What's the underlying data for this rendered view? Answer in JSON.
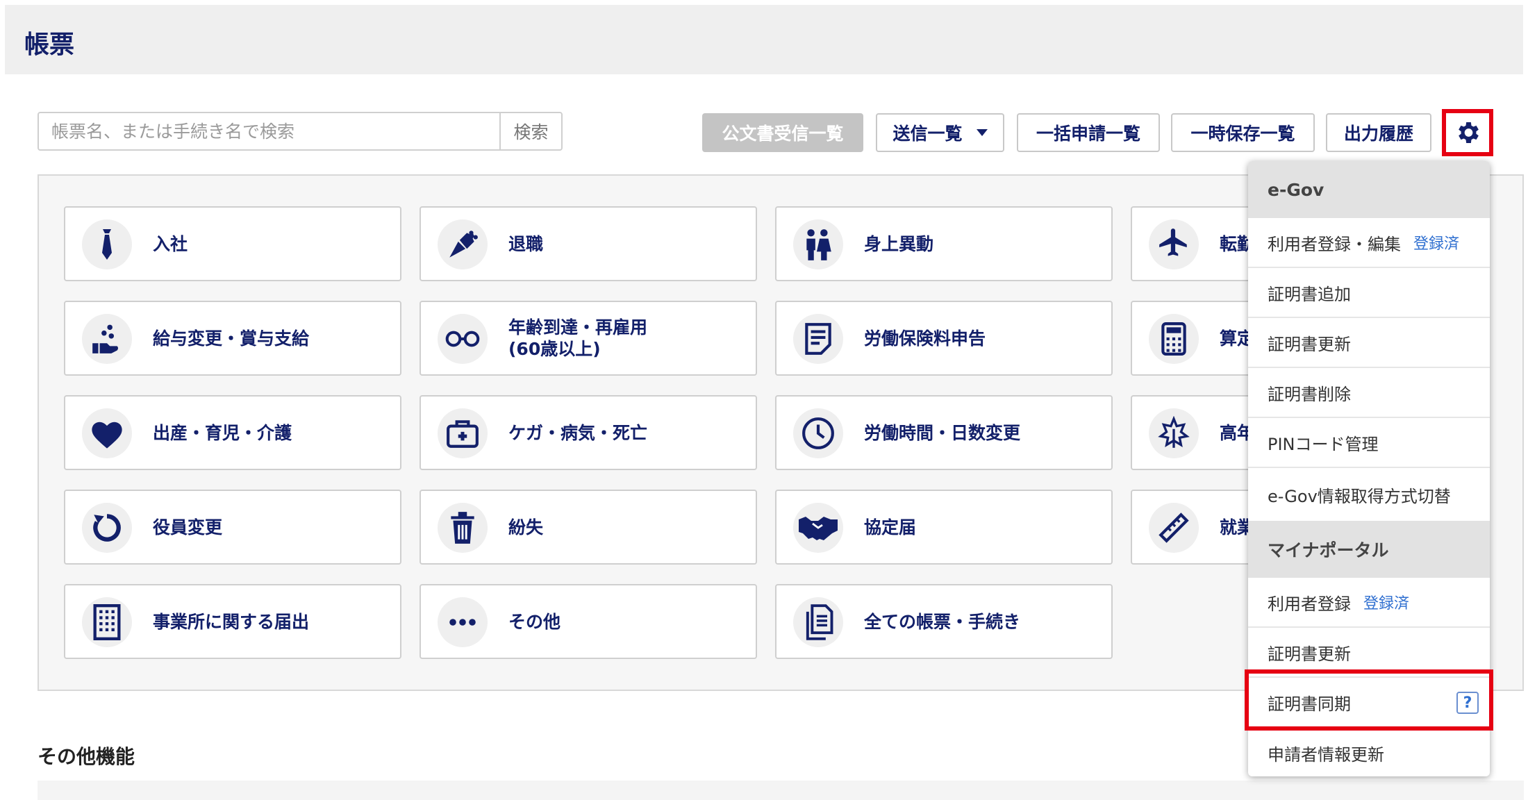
{
  "header": {
    "title": "帳票"
  },
  "search": {
    "placeholder": "帳票名、または手続き名で検索",
    "button_label": "検索"
  },
  "toolbar": {
    "official_docs_label": "公文書受信一覧",
    "sent_list_label": "送信一覧",
    "bulk_apply_label": "一括申請一覧",
    "temp_saved_label": "一時保存一覧",
    "output_history_label": "出力履歴"
  },
  "cards": [
    {
      "label": "入社",
      "icon": "necktie-icon"
    },
    {
      "label": "退職",
      "icon": "bouquet-icon"
    },
    {
      "label": "身上異動",
      "icon": "couple-icon"
    },
    {
      "label": "転勤",
      "icon": "airplane-icon"
    },
    {
      "label": "給与変更・賞与支給",
      "icon": "hand-coins-icon"
    },
    {
      "label": "年齢到達・再雇用\n(60歳以上)",
      "icon": "glasses-icon"
    },
    {
      "label": "労働保険料申告",
      "icon": "document-icon"
    },
    {
      "label": "算定",
      "icon": "calculator-icon"
    },
    {
      "label": "出産・育児・介護",
      "icon": "heart-icon"
    },
    {
      "label": "ケガ・病気・死亡",
      "icon": "first-aid-icon"
    },
    {
      "label": "労働時間・日数変更",
      "icon": "clock-icon"
    },
    {
      "label": "高年",
      "icon": "leaf-icon"
    },
    {
      "label": "役員変更",
      "icon": "refresh-icon"
    },
    {
      "label": "紛失",
      "icon": "trash-icon"
    },
    {
      "label": "協定届",
      "icon": "handshake-icon"
    },
    {
      "label": "就業",
      "icon": "ruler-icon"
    },
    {
      "label": "事業所に関する届出",
      "icon": "building-icon"
    },
    {
      "label": "その他",
      "icon": "ellipsis-icon"
    },
    {
      "label": "全ての帳票・手続き",
      "icon": "documents-icon"
    }
  ],
  "other_features": {
    "title": "その他機能"
  },
  "dropdown": {
    "egov_header": "e-Gov",
    "egov_items": [
      {
        "label": "利用者登録・編集",
        "badge": "登録済"
      },
      {
        "label": "証明書追加"
      },
      {
        "label": "証明書更新"
      },
      {
        "label": "証明書削除"
      },
      {
        "label": "PINコード管理"
      },
      {
        "label": "e-Gov情報取得方式切替"
      }
    ],
    "myna_header": "マイナポータル",
    "myna_items": [
      {
        "label": "利用者登録",
        "badge": "登録済"
      },
      {
        "label": "証明書更新"
      },
      {
        "label": "証明書同期",
        "help": "?"
      },
      {
        "label": "申請者情報更新"
      }
    ]
  },
  "colors": {
    "navy": "#13206a",
    "highlight_red": "#e60012",
    "link_blue": "#2f6fd0"
  }
}
